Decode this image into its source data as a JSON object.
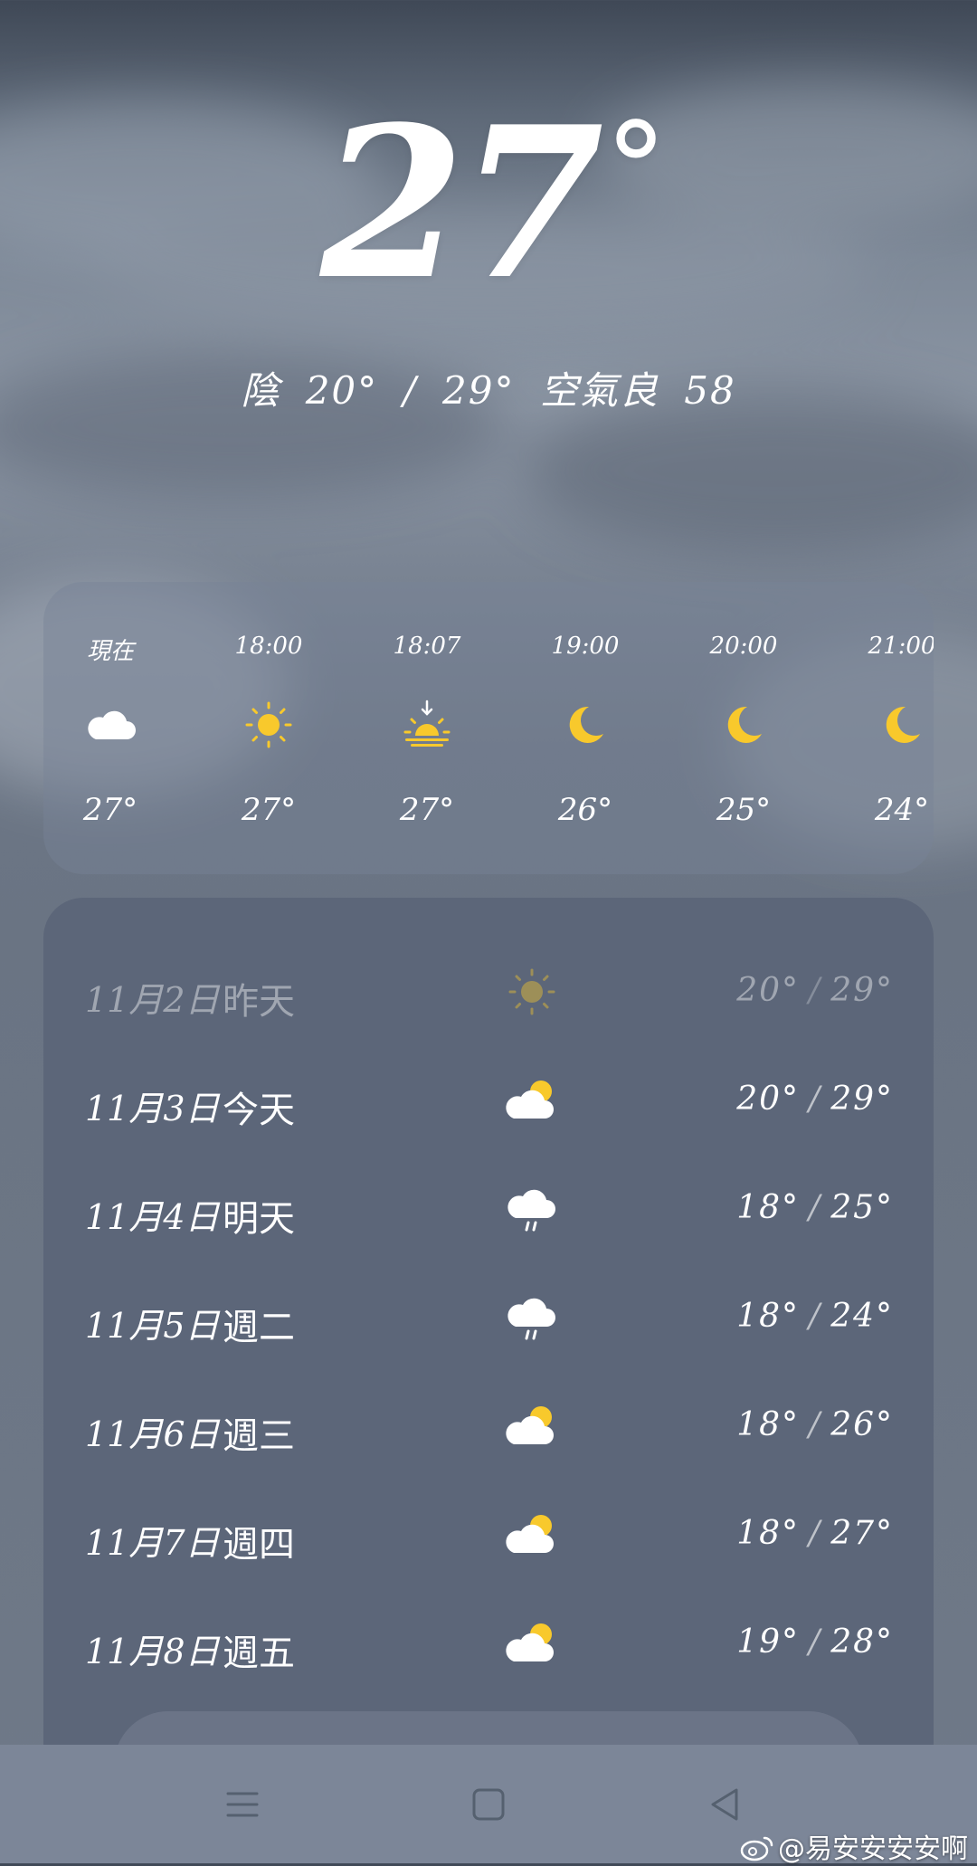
{
  "current": {
    "temp": "27",
    "degree": "°",
    "condition": "陰",
    "low": "20°",
    "separator": "/",
    "high": "29°",
    "aqi_label": "空氣良",
    "aqi_value": "58"
  },
  "hourly": [
    {
      "time": "現在",
      "icon": "cloud-icon",
      "temp": "27°"
    },
    {
      "time": "18:00",
      "icon": "sun-icon",
      "temp": "27°"
    },
    {
      "time": "18:07",
      "icon": "sunset-icon",
      "temp": "27°"
    },
    {
      "time": "19:00",
      "icon": "moon-icon",
      "temp": "26°"
    },
    {
      "time": "20:00",
      "icon": "moon-icon",
      "temp": "25°"
    },
    {
      "time": "21:00",
      "icon": "moon-icon",
      "temp": "24°"
    }
  ],
  "daily": [
    {
      "date": "11月2日",
      "day": "昨天",
      "icon": "sun-icon",
      "low": "20°",
      "high": "29°"
    },
    {
      "date": "11月3日",
      "day": "今天",
      "icon": "partly-cloudy-icon",
      "low": "20°",
      "high": "29°"
    },
    {
      "date": "11月4日",
      "day": "明天",
      "icon": "rain-icon",
      "low": "18°",
      "high": "25°"
    },
    {
      "date": "11月5日",
      "day": "週二",
      "icon": "rain-icon",
      "low": "18°",
      "high": "24°"
    },
    {
      "date": "11月6日",
      "day": "週三",
      "icon": "partly-cloudy-icon",
      "low": "18°",
      "high": "26°"
    },
    {
      "date": "11月7日",
      "day": "週四",
      "icon": "partly-cloudy-icon",
      "low": "18°",
      "high": "27°"
    },
    {
      "date": "11月8日",
      "day": "週五",
      "icon": "partly-cloudy-icon",
      "low": "19°",
      "high": "28°"
    }
  ],
  "watermark": "@易安安安安啊",
  "colors": {
    "sun": "#f8c92c",
    "card": "#5c6679",
    "text": "#ffffff"
  }
}
